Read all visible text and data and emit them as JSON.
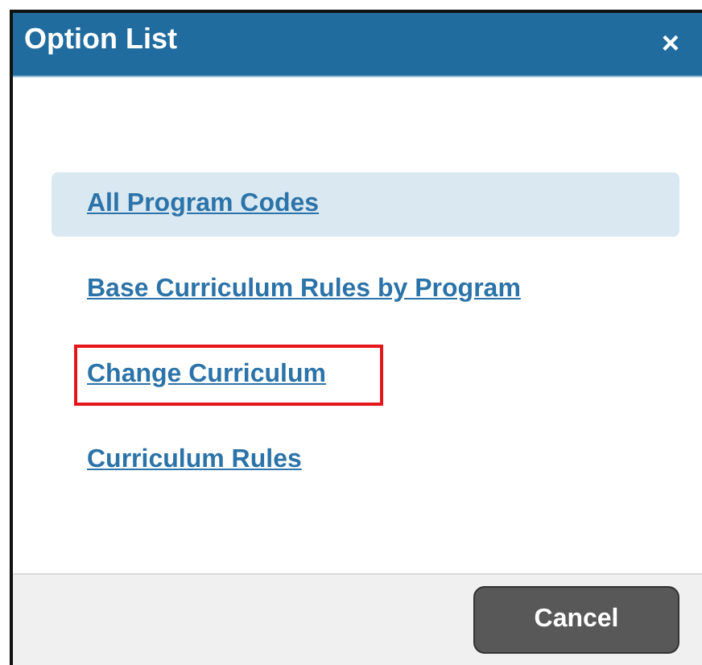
{
  "dialog": {
    "title": "Option List",
    "close": "×"
  },
  "options": [
    {
      "label": "All Program Codes",
      "selected": true,
      "highlighted": false
    },
    {
      "label": "Base Curriculum Rules by Program",
      "selected": false,
      "highlighted": false
    },
    {
      "label": "Change Curriculum",
      "selected": false,
      "highlighted": true
    },
    {
      "label": "Curriculum Rules",
      "selected": false,
      "highlighted": false
    }
  ],
  "buttons": [
    "Cancel"
  ]
}
